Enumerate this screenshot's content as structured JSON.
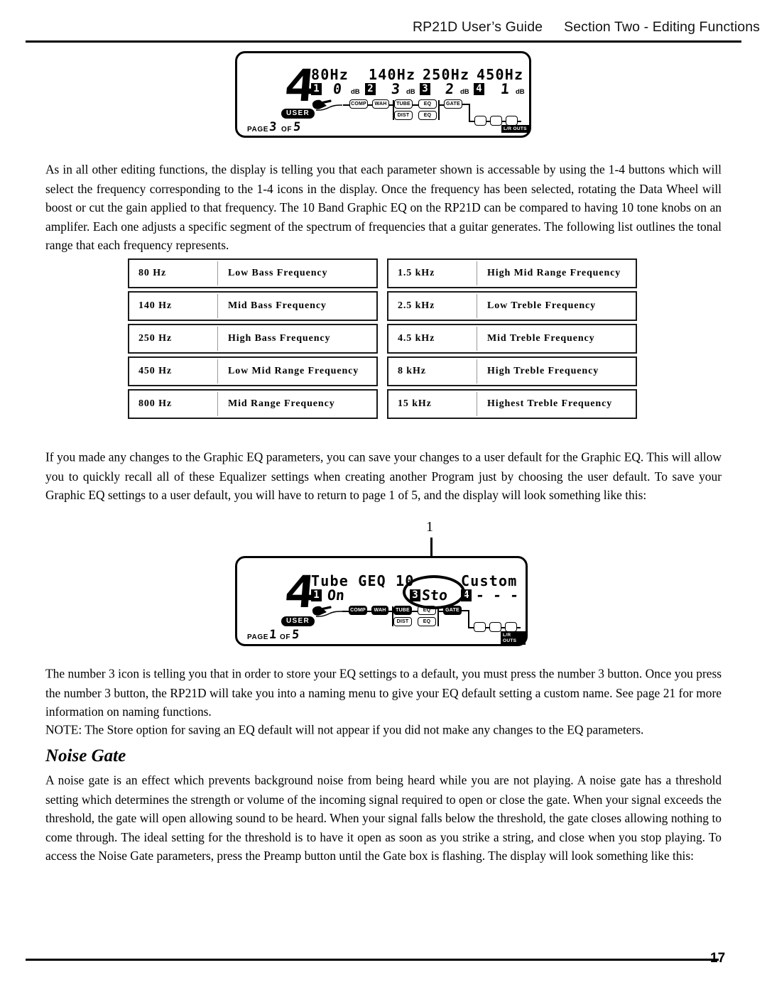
{
  "header": {
    "guide_title": "RP21D User’s Guide",
    "section_title": "Section Two - Editing Functions"
  },
  "footer": {
    "page_number": "17"
  },
  "paragraphs": {
    "intro": "As in all other editing functions, the display is telling you that each parameter shown is accessable by using the 1-4 buttons which will select the frequency corresponding to the 1-4 icons in the display. Once the frequency has been selected, rotating the Data Wheel will boost or cut the gain applied to that frequency. The 10 Band Graphic EQ on the RP21D can be compared to having 10 tone knobs on an amplifer. Each one adjusts a specific segment of the spectrum of frequencies that a guitar generates. The following list outlines the tonal range that each frequency represents.",
    "user_default": "If you made any changes to the Graphic EQ parameters, you can save your changes to a user default for the Graphic EQ.  This will allow you to quickly recall all of these Equalizer settings when creating another Program just by choosing the user default. To save your Graphic EQ settings to a user default, you will have to return to page 1 of 5, and the display will look something like this:",
    "number_three": "The number 3 icon is telling you that in order to store your EQ settings to a default, you must press the number 3 button. Once you press the number 3 button, the RP21D will take you into a naming menu to give your EQ default setting a custom name. See page 21 for more information on naming functions.",
    "note": "NOTE: The Store option for saving an EQ default will not appear if you did not make any changes to the EQ parameters.",
    "noise_gate_body": "A noise gate is an effect which prevents background noise from being heard while you are not playing. A noise gate has a threshold setting which determines the strength or volume of the incoming signal required to open or close the gate.  When your signal exceeds the threshold, the gate will open allowing sound to be heard. When your signal falls below the threshold, the gate closes allowing nothing to come through. The ideal setting for the threshold is to have it open as soon as you strike a string, and close when you stop playing. To access the Noise Gate parameters, press the Preamp button until the Gate box is flashing. The display will look something like this:"
  },
  "sections": {
    "noise_gate_heading": "Noise Gate"
  },
  "freq_table_left": [
    {
      "freq": "80 Hz",
      "desc": "Low Bass Frequency"
    },
    {
      "freq": "140 Hz",
      "desc": "Mid Bass Frequency"
    },
    {
      "freq": "250 Hz",
      "desc": "High Bass Frequency"
    },
    {
      "freq": "450 Hz",
      "desc": "Low Mid Range Frequency"
    },
    {
      "freq": "800 Hz",
      "desc": "Mid Range Frequency"
    }
  ],
  "freq_table_right": [
    {
      "freq": "1.5 kHz",
      "desc": "High Mid Range Frequency"
    },
    {
      "freq": "2.5 kHz",
      "desc": "Low Treble Frequency"
    },
    {
      "freq": "4.5 kHz",
      "desc": "Mid Treble Frequency"
    },
    {
      "freq": "8 kHz",
      "desc": "High Treble Frequency"
    },
    {
      "freq": "15 kHz",
      "desc": "Highest Treble Frequency"
    }
  ],
  "lcd_top": {
    "preset_number": "4",
    "user_badge": "USER",
    "page_label_prefix": "PAGE",
    "page_current": "3",
    "page_of": "OF",
    "page_total": "5",
    "bands": [
      {
        "index": "1",
        "freq": "80Hz",
        "value": "0",
        "unit": "dB"
      },
      {
        "index": "2",
        "freq": "140Hz",
        "value": "3",
        "unit": "dB"
      },
      {
        "index": "3",
        "freq": "250Hz",
        "value": "2",
        "unit": "dB"
      },
      {
        "index": "4",
        "freq": "450Hz",
        "value": "1",
        "unit": "dB"
      }
    ],
    "chain": [
      "COMP",
      "WAH",
      "TUBE",
      "DIST",
      "EQ",
      "EQ",
      "GATE"
    ],
    "outs_label": "L/R OUTS"
  },
  "lcd_bottom": {
    "preset_number": "4",
    "user_badge": "USER",
    "page_label_prefix": "PAGE",
    "page_current": "1",
    "page_of": "OF",
    "page_total": "5",
    "line1_left": "Tube GEQ 10",
    "line1_right": "Custom",
    "param1_index": "1",
    "param1_value": "On",
    "param3_index": "3",
    "param3_value": "Sto",
    "param4_index": "4",
    "param4_value": "- - -",
    "chain": [
      "COMP",
      "WAH",
      "TUBE",
      "DIST",
      "EQ",
      "EQ",
      "GATE"
    ],
    "outs_label": "L/R OUTS",
    "callout_label": "1"
  }
}
